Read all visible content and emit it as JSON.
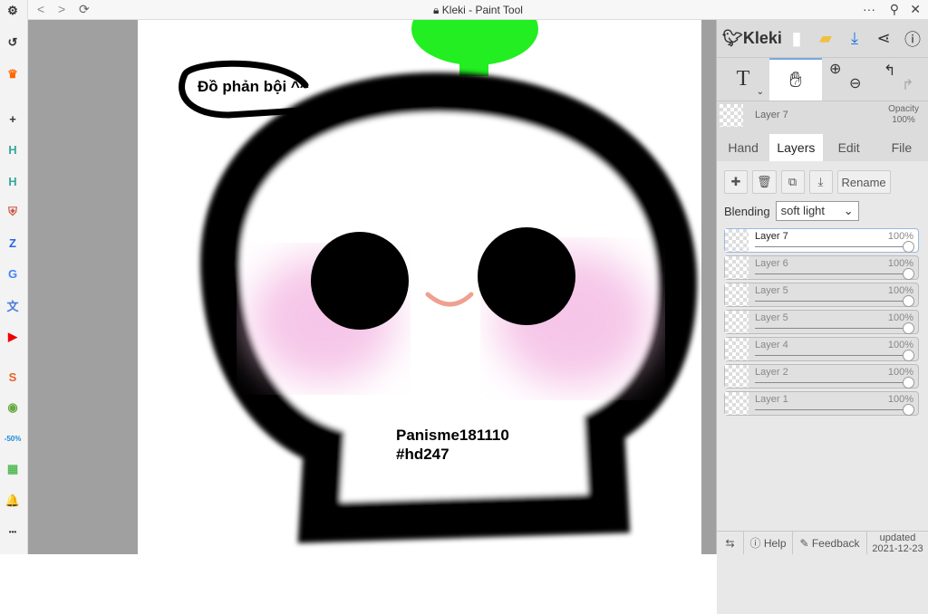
{
  "browser": {
    "title": "Kleki - Paint Tool",
    "back": "<",
    "forward": ">",
    "reload": "⟳",
    "more": "···",
    "pin": "⚲",
    "close": "✕"
  },
  "sidebar": {
    "items": [
      {
        "icon": "gear-icon",
        "glyph": "⚙"
      },
      {
        "icon": "history-icon",
        "glyph": "↺"
      },
      {
        "icon": "crown-icon",
        "glyph": "♛"
      },
      {
        "icon": "plus-icon",
        "glyph": "+"
      },
      {
        "icon": "h-app-icon",
        "glyph": "H"
      },
      {
        "icon": "h-app-icon-2",
        "glyph": "H"
      },
      {
        "icon": "shield-icon",
        "glyph": "⛨"
      },
      {
        "icon": "zalo-icon",
        "glyph": "Z"
      },
      {
        "icon": "google-icon",
        "glyph": "G"
      },
      {
        "icon": "translate-icon",
        "glyph": "文"
      },
      {
        "icon": "youtube-icon",
        "glyph": "▶"
      },
      {
        "icon": "shopee-icon",
        "glyph": "S"
      },
      {
        "icon": "app-icon",
        "glyph": "◉"
      },
      {
        "icon": "tiki-icon",
        "glyph": "-50%"
      },
      {
        "icon": "sheets-icon",
        "glyph": "▦"
      },
      {
        "icon": "bell-icon",
        "glyph": "🔔"
      },
      {
        "icon": "more-icon",
        "glyph": "•••"
      }
    ]
  },
  "canvas": {
    "bubble_text": "Đồ phản bội ^^",
    "signature_line1": "Panisme181110",
    "signature_line2": "#hd247"
  },
  "panel": {
    "logo": "Kleki",
    "current_layer": "Layer 7",
    "opacity_label": "Opacity",
    "opacity_value": "100%",
    "tabs": [
      "Hand",
      "Layers",
      "Edit",
      "File"
    ],
    "active_tab": "Layers",
    "rename": "Rename",
    "blending_label": "Blending",
    "blending_value": "soft light",
    "layers": [
      {
        "name": "Layer 7",
        "opacity": "100%"
      },
      {
        "name": "Layer 6",
        "opacity": "100%"
      },
      {
        "name": "Layer 5",
        "opacity": "100%"
      },
      {
        "name": "Layer 5",
        "opacity": "100%"
      },
      {
        "name": "Layer 4",
        "opacity": "100%"
      },
      {
        "name": "Layer 2",
        "opacity": "100%"
      },
      {
        "name": "Layer 1",
        "opacity": "100%"
      }
    ],
    "help": "Help",
    "feedback": "Feedback",
    "updated_label": "updated",
    "updated_date": "2021-12-23",
    "accent": "#1a73e8"
  }
}
